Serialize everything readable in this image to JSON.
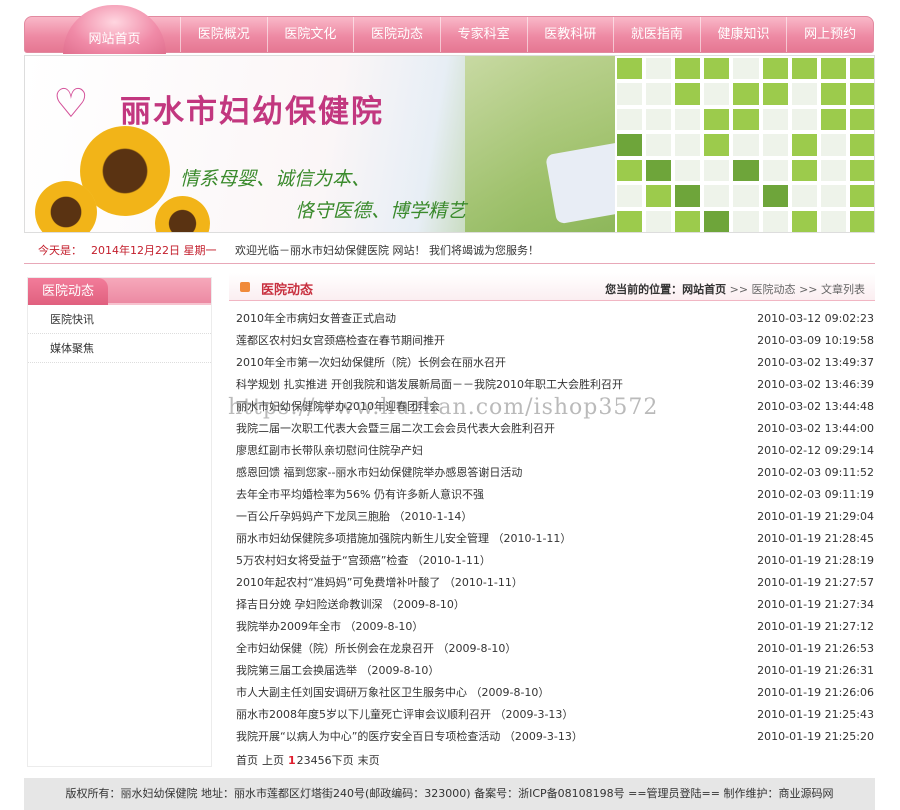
{
  "nav": {
    "home": "网站首页",
    "items": [
      "医院概况",
      "医院文化",
      "医院动态",
      "专家科室",
      "医教科研",
      "就医指南",
      "健康知识",
      "网上预约"
    ]
  },
  "banner": {
    "title": "丽水市妇幼保健院",
    "slogan1": "情系母婴、诚信为本、",
    "slogan2": "恪守医德、博学精艺"
  },
  "datebar": {
    "date_label": "今天是：",
    "date": "2014年12月22日 星期一",
    "welcome": "欢迎光临－丽水市妇幼保健医院 网站！ 我们将竭诚为您服务！"
  },
  "sidebar": {
    "title": "医院动态",
    "items": [
      "医院快讯",
      "媒体聚焦"
    ]
  },
  "main": {
    "title": "医院动态",
    "crumb_label": "您当前的位置：",
    "crumb_home": "网站首页",
    "crumb_section": ">> 医院动态",
    "crumb_current": ">> 文章列表",
    "articles": [
      {
        "title": "2010年全市病妇女普查正式启动",
        "time": "2010-03-12 09:02:23"
      },
      {
        "title": "莲都区农村妇女宫颈癌检查在春节期间推开",
        "time": "2010-03-09 10:19:58"
      },
      {
        "title": "2010年全市第一次妇幼保健所（院）长例会在丽水召开",
        "time": "2010-03-02 13:49:37"
      },
      {
        "title": "科学规划 扎实推进 开创我院和谐发展新局面－－我院2010年职工大会胜利召开",
        "time": "2010-03-02 13:46:39"
      },
      {
        "title": "丽水市妇幼保健院举办2010年迎春团拜会",
        "time": "2010-03-02 13:44:48"
      },
      {
        "title": "我院二届一次职工代表大会暨三届二次工会会员代表大会胜利召开",
        "time": "2010-03-02 13:44:00"
      },
      {
        "title": "廖思红副市长带队亲切慰问住院孕产妇",
        "time": "2010-02-12 09:29:14"
      },
      {
        "title": "感恩回馈 福到您家--丽水市妇幼保健院举办感恩答谢日活动",
        "time": "2010-02-03 09:11:52"
      },
      {
        "title": "去年全市平均婚检率为56% 仍有许多新人意识不强",
        "time": "2010-02-03 09:11:19"
      },
      {
        "title": "一百公斤孕妈妈产下龙凤三胞胎 （2010-1-14）",
        "time": "2010-01-19 21:29:04"
      },
      {
        "title": "丽水市妇幼保健院多项措施加强院内新生儿安全管理 （2010-1-11）",
        "time": "2010-01-19 21:28:45"
      },
      {
        "title": "5万农村妇女将受益于“宫颈癌”检查 （2010-1-11）",
        "time": "2010-01-19 21:28:19"
      },
      {
        "title": "2010年起农村“准妈妈”可免费增补叶酸了 （2010-1-11）",
        "time": "2010-01-19 21:27:57"
      },
      {
        "title": "择吉日分娩 孕妇险送命教训深 （2009-8-10）",
        "time": "2010-01-19 21:27:34"
      },
      {
        "title": "我院举办2009年全市 （2009-8-10）",
        "time": "2010-01-19 21:27:12"
      },
      {
        "title": "全市妇幼保健（院）所长例会在龙泉召开 （2009-8-10）",
        "time": "2010-01-19 21:26:53"
      },
      {
        "title": "我院第三届工会换届选举 （2009-8-10）",
        "time": "2010-01-19 21:26:31"
      },
      {
        "title": "市人大副主任刘国安调研万象社区卫生服务中心 （2009-8-10）",
        "time": "2010-01-19 21:26:06"
      },
      {
        "title": "丽水市2008年度5岁以下儿童死亡评审会议顺利召开 （2009-3-13）",
        "time": "2010-01-19 21:25:43"
      },
      {
        "title": "我院开展“以病人为中心”的医疗安全百日专项检查活动 （2009-3-13）",
        "time": "2010-01-19 21:25:20"
      }
    ],
    "pager": {
      "first": "首页",
      "prev": "上页",
      "current": "1",
      "pages": "23456",
      "next": "下页",
      "last": "末页"
    }
  },
  "watermark": "https://www.huzhan.com/ishop3572",
  "footer": "版权所有：丽水妇幼保健院 地址：丽水市莲都区灯塔街240号(邮政编码：323000) 备案号：浙ICP备08108198号   ==管理员登陆==   制作维护：商业源码网"
}
